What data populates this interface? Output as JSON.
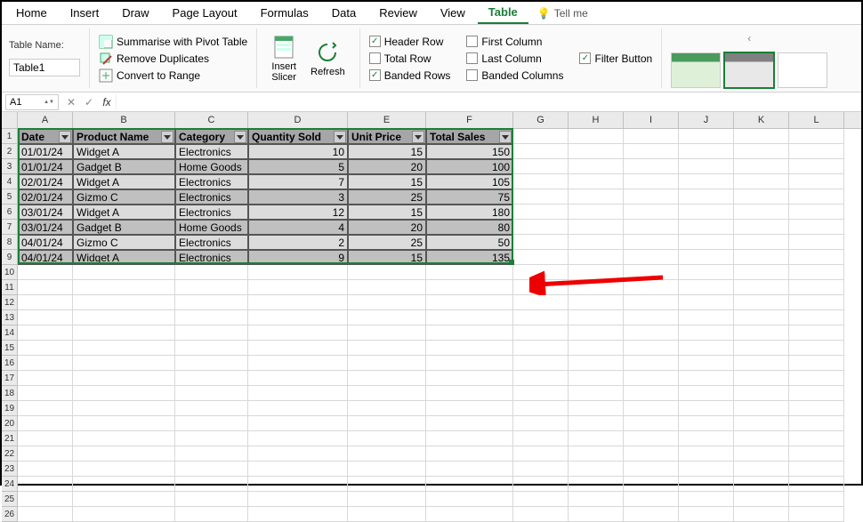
{
  "ribbon": {
    "tabs": [
      "Home",
      "Insert",
      "Draw",
      "Page Layout",
      "Formulas",
      "Data",
      "Review",
      "View",
      "Table"
    ],
    "active_tab": "Table",
    "tell_me": "Tell me",
    "table_name_label": "Table Name:",
    "table_name_value": "Table1",
    "tools": {
      "pivot": "Summarise with Pivot Table",
      "dup": "Remove Duplicates",
      "range": "Convert to Range",
      "slicer": "Insert\nSlicer",
      "refresh": "Refresh"
    },
    "options": {
      "header_row": {
        "label": "Header Row",
        "checked": true
      },
      "total_row": {
        "label": "Total Row",
        "checked": false
      },
      "banded_rows": {
        "label": "Banded Rows",
        "checked": true
      },
      "first_col": {
        "label": "First Column",
        "checked": false
      },
      "last_col": {
        "label": "Last Column",
        "checked": false
      },
      "banded_cols": {
        "label": "Banded Columns",
        "checked": false
      },
      "filter_btn": {
        "label": "Filter Button",
        "checked": true
      }
    }
  },
  "namebox": "A1",
  "columns": [
    "A",
    "B",
    "C",
    "D",
    "E",
    "F",
    "G",
    "H",
    "I",
    "J",
    "K",
    "L"
  ],
  "chart_data": {
    "type": "table",
    "headers": [
      "Date",
      "Product Name",
      "Category",
      "Quantity Sold",
      "Unit Price",
      "Total Sales"
    ],
    "rows": [
      [
        "01/01/24",
        "Widget A",
        "Electronics",
        "10",
        "15",
        "150"
      ],
      [
        "01/01/24",
        "Gadget B",
        "Home Goods",
        "5",
        "20",
        "100"
      ],
      [
        "02/01/24",
        "Widget A",
        "Electronics",
        "7",
        "15",
        "105"
      ],
      [
        "02/01/24",
        "Gizmo C",
        "Electronics",
        "3",
        "25",
        "75"
      ],
      [
        "03/01/24",
        "Widget A",
        "Electronics",
        "12",
        "15",
        "180"
      ],
      [
        "03/01/24",
        "Gadget B",
        "Home Goods",
        "4",
        "20",
        "80"
      ],
      [
        "04/01/24",
        "Gizmo C",
        "Electronics",
        "2",
        "25",
        "50"
      ],
      [
        "04/01/24",
        "Widget A",
        "Electronics",
        "9",
        "15",
        "135"
      ]
    ]
  },
  "row_count_empty": 17
}
